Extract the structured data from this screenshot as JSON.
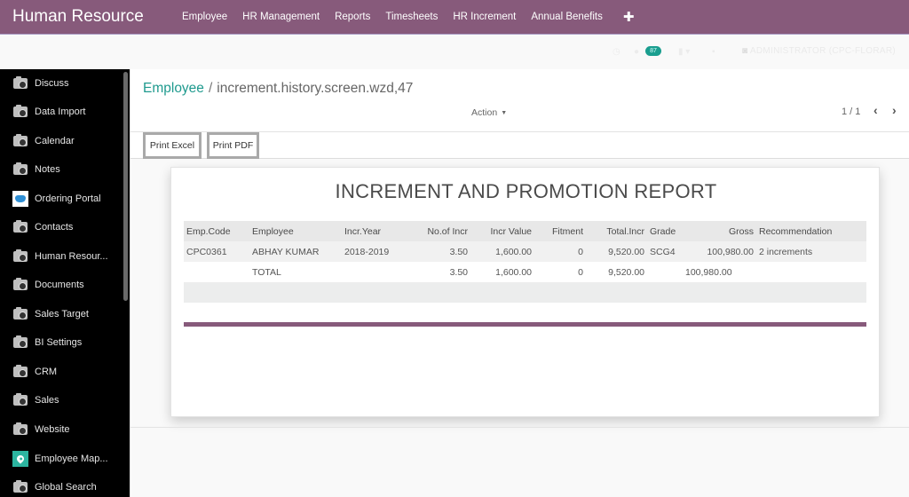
{
  "app": {
    "title": "Human Resource",
    "brand_color": "#875a7b",
    "accent_color": "#1f9a8e"
  },
  "topnav": {
    "items": [
      {
        "label": "Employee"
      },
      {
        "label": "HR Management"
      },
      {
        "label": "Reports"
      },
      {
        "label": "Timesheets"
      },
      {
        "label": "HR Increment"
      },
      {
        "label": "Annual Benefits"
      }
    ],
    "add_icon": "plus-icon"
  },
  "systray": {
    "messages_badge": "87",
    "user_label": "ADMINISTRATOR (CPC-FLORAR)"
  },
  "sidebar": {
    "items": [
      {
        "label": "Discuss",
        "icon": "camera-icon"
      },
      {
        "label": "Data Import",
        "icon": "camera-icon"
      },
      {
        "label": "Calendar",
        "icon": "camera-icon"
      },
      {
        "label": "Notes",
        "icon": "camera-icon"
      },
      {
        "label": "Ordering Portal",
        "icon": "handshake-icon"
      },
      {
        "label": "Contacts",
        "icon": "camera-icon"
      },
      {
        "label": "Human Resour...",
        "icon": "camera-icon"
      },
      {
        "label": "Documents",
        "icon": "camera-icon"
      },
      {
        "label": "Sales Target",
        "icon": "camera-icon"
      },
      {
        "label": "BI Settings",
        "icon": "camera-icon"
      },
      {
        "label": "CRM",
        "icon": "camera-icon"
      },
      {
        "label": "Sales",
        "icon": "camera-icon"
      },
      {
        "label": "Website",
        "icon": "camera-icon"
      },
      {
        "label": "Employee Map...",
        "icon": "map-pin-icon"
      },
      {
        "label": "Global Search",
        "icon": "camera-icon"
      }
    ]
  },
  "control_panel": {
    "breadcrumb": {
      "parent": "Employee",
      "separator": "/",
      "current": "increment.history.screen.wzd,47"
    },
    "action_label": "Action",
    "pager": "1 / 1",
    "buttons": {
      "print_excel": "Print Excel",
      "print_pdf": "Print PDF"
    }
  },
  "report": {
    "title": "INCREMENT AND PROMOTION REPORT",
    "columns": [
      "Emp.Code",
      "Employee",
      "Incr.Year",
      "No.of Incr",
      "Incr Value",
      "Fitment",
      "Total.Incr",
      "Grade",
      "Gross",
      "Recommendation"
    ],
    "rows": [
      [
        "CPC0361",
        "ABHAY KUMAR",
        "2018-2019",
        "3.50",
        "1,600.00",
        "0",
        "9,520.00",
        "SCG4",
        "100,980.00",
        "2 increments"
      ]
    ],
    "total": [
      "",
      "TOTAL",
      "",
      "3.50",
      "1,600.00",
      "0",
      "9,520.00",
      "",
      "100,980.00",
      ""
    ]
  }
}
